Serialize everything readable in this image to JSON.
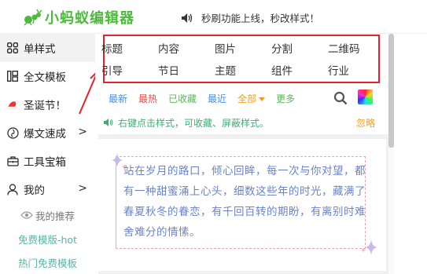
{
  "header": {
    "logo_text": "小蚂蚁编辑器",
    "notice": "秒刷功能上线，秒改样式！",
    "brand_color": "#4cbb3c"
  },
  "sidebar": {
    "items": [
      {
        "label": "单样式",
        "icon": "grid-icon",
        "active": true
      },
      {
        "label": "全文模板",
        "icon": "template-icon"
      },
      {
        "label": "圣诞节！",
        "icon": "santa-hat-icon"
      },
      {
        "label": "爆文速成",
        "icon": "fire-icon",
        "chevron": ">"
      },
      {
        "label": "工具宝箱",
        "icon": "toolbox-icon"
      },
      {
        "label": "我的",
        "icon": "user-icon",
        "chevron": ">"
      }
    ],
    "sub_items": [
      {
        "label": "我的推荐",
        "icon": "eye-icon"
      },
      {
        "label": "免费模版-hot"
      },
      {
        "label": "热门免费模板"
      }
    ]
  },
  "categories": {
    "row1": [
      "标题",
      "内容",
      "图片",
      "分割",
      "二维码"
    ],
    "row2": [
      "引导",
      "节日",
      "主题",
      "组件",
      "行业"
    ],
    "highlight_color": "#e0242d"
  },
  "filters": {
    "new": "最新",
    "hot": "最热",
    "favorited": "已收藏",
    "recent": "最近",
    "all": "全部",
    "more": "更多"
  },
  "tip": {
    "text": "右键点击样式，可收藏、屏蔽样式。",
    "ignore": "忽略"
  },
  "card": {
    "quote": "站在岁月的路口，倾心回眸，每一次与你对望，都有一种甜蜜涌上心头，细数这些年的时光，藏满了春夏秋冬的眷恋，有千回百转的期盼，有离别时难舍难分的情愫。"
  }
}
